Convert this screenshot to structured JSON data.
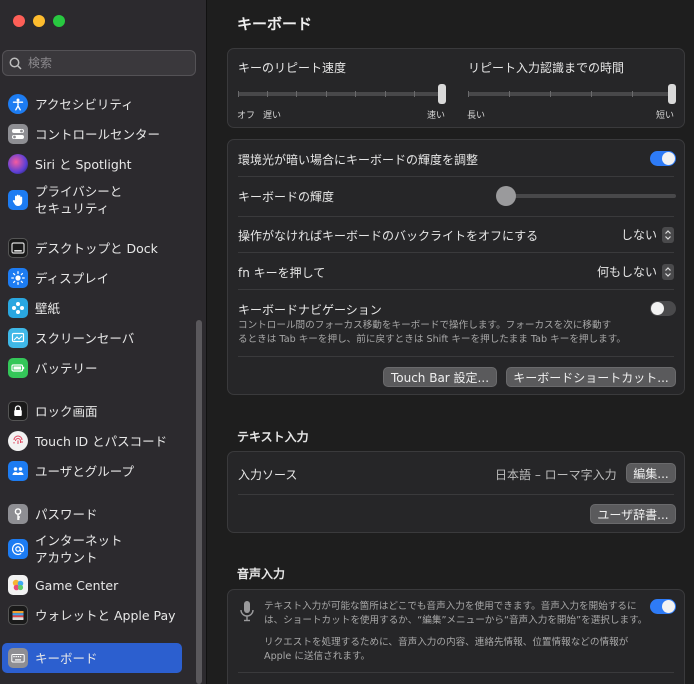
{
  "sidebar": {
    "search_placeholder": "検索",
    "items": [
      {
        "label": "アクセシビリティ",
        "icon": "accessibility-icon",
        "color": "#1d7cf2"
      },
      {
        "label": "コントロールセンター",
        "icon": "control-center-icon",
        "color": "#8e8e93"
      },
      {
        "label": "Siri と Spotlight",
        "icon": "siri-icon",
        "color": "#5b3fd6"
      },
      {
        "label": "プライバシーと",
        "label2": "セキュリティ",
        "icon": "privacy-hand-icon",
        "color": "#1d7cf2"
      },
      {
        "label": "デスクトップと Dock",
        "icon": "desktop-dock-icon",
        "color": "#1a1a1a"
      },
      {
        "label": "ディスプレイ",
        "icon": "display-sun-icon",
        "color": "#1d7cf2"
      },
      {
        "label": "壁紙",
        "icon": "wallpaper-icon",
        "color": "#2aa7e0"
      },
      {
        "label": "スクリーンセーバ",
        "icon": "screensaver-icon",
        "color": "#3fb8e8"
      },
      {
        "label": "バッテリー",
        "icon": "battery-icon",
        "color": "#34c759"
      },
      {
        "label": "ロック画面",
        "icon": "lock-icon",
        "color": "#1a1a1a"
      },
      {
        "label": "Touch ID とパスコード",
        "icon": "fingerprint-icon",
        "color": "#f2f2f2"
      },
      {
        "label": "ユーザとグループ",
        "icon": "users-icon",
        "color": "#1d7cf2"
      },
      {
        "label": "パスワード",
        "icon": "key-icon",
        "color": "#8e8e93"
      },
      {
        "label": "インターネット",
        "label2": "アカウント",
        "icon": "at-sign-icon",
        "color": "#1d7cf2"
      },
      {
        "label": "Game Center",
        "icon": "game-center-icon",
        "color": "#f2f2f2"
      },
      {
        "label": "ウォレットと Apple Pay",
        "icon": "wallet-icon",
        "color": "#1a1a1a"
      },
      {
        "label": "キーボード",
        "icon": "keyboard-icon",
        "color": "#8e8e93",
        "active": true
      }
    ]
  },
  "main": {
    "title": "キーボード",
    "repeat": {
      "key_repeat_label": "キーのリピート速度",
      "delay_label": "リピート入力認識までの時間",
      "repeat_min": "オフ",
      "repeat_slow": "遅い",
      "repeat_fast": "速い",
      "delay_long": "長い",
      "delay_short": "短い",
      "key_repeat_value": 1.0,
      "delay_value": 1.0
    },
    "brightness_auto_label": "環境光が暗い場合にキーボードの輝度を調整",
    "brightness_auto_on": true,
    "brightness_label": "キーボードの輝度",
    "brightness_value": 0.0,
    "backlight_off_label": "操作がなければキーボードのバックライトをオフにする",
    "backlight_off_value": "しない",
    "fn_label": "fn キーを押して",
    "fn_value": "何もしない",
    "nav_label": "キーボードナビゲーション",
    "nav_on": false,
    "nav_desc1": "コントロール間のフォーカス移動をキーボードで操作します。フォーカスを次に移動す",
    "nav_desc2": "るときは Tab キーを押し、前に戻すときは Shift キーを押したまま Tab キーを押します。",
    "touchbar_button": "Touch Bar 設定...",
    "shortcut_button": "キーボードショートカット...",
    "text_input_title": "テキスト入力",
    "input_source_label": "入力ソース",
    "input_source_value": "日本語 – ローマ字入力",
    "edit_button": "編集...",
    "user_dict_button": "ユーザ辞書...",
    "dictation_title": "音声入力",
    "dictation_desc1": "テキスト入力が可能な箇所はどこでも音声入力を使用できます。音声入力を開始するに",
    "dictation_desc2": "は、ショートカットを使用するか、“編集”メニューから“音声入力を開始”を選択します。",
    "dictation_desc3": "リクエストを処理するために、音声入力の内容、連絡先情報、位置情報などの情報が",
    "dictation_desc4": "Apple に送信されます。",
    "dictation_on": true
  }
}
